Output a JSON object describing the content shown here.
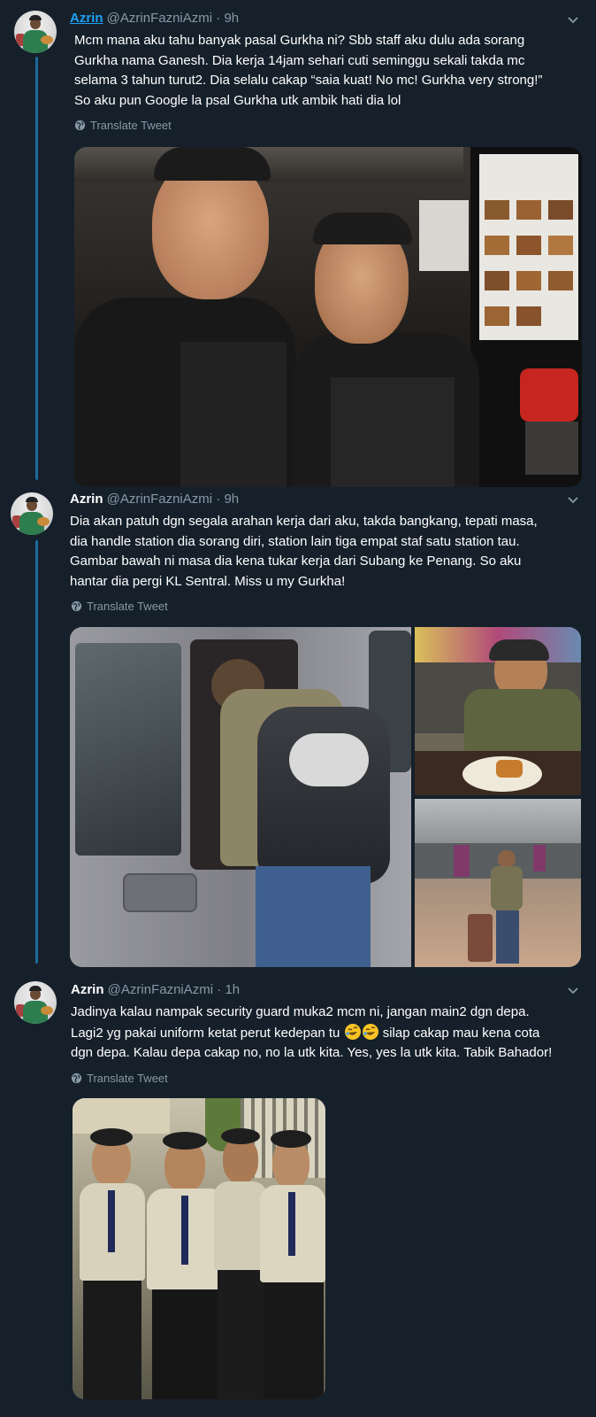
{
  "tweets": [
    {
      "name": "Azrin",
      "handle": "@AzrinFazniAzmi",
      "time": "9h",
      "lines": [
        "Mcm mana aku tahu banyak pasal Gurkha ni? Sbb staff aku dulu ada sorang",
        "Gurkha nama Ganesh. Dia kerja 14jam sehari cuti seminggu sekali takda mc",
        "selama 3 tahun turut2. Dia selalu cakap “saia kuat! No mc! Gurkha very strong!”",
        "So aku pun Google la psal Gurkha utk ambik hati dia lol"
      ],
      "translate": "Translate Tweet"
    },
    {
      "name": "Azrin",
      "handle": "@AzrinFazniAzmi",
      "time": "9h",
      "lines": [
        "Dia akan patuh dgn segala arahan kerja dari aku, takda bangkang, tepati masa,",
        "dia handle station dia sorang diri, station lain tiga empat staf satu station tau.",
        "Gambar bawah ni masa dia kena tukar kerja dari Subang ke Penang. So aku",
        "hantar dia pergi KL Sentral. Miss u my Gurkha!"
      ],
      "translate": "Translate Tweet"
    },
    {
      "name": "Azrin",
      "handle": "@AzrinFazniAzmi",
      "time": "1h",
      "line1": "Jadinya kalau nampak security guard muka2 mcm ni, jangan main2 dgn depa.",
      "line2a": "Lagi2 yg pakai uniform ketat perut kedepan tu",
      "line2b": "silap cakap mau kena cota",
      "line3": "dgn depa. Kalau depa cakap no, no la utk kita. Yes, yes la utk kita. Tabik Bahador!",
      "translate": "Translate Tweet"
    }
  ],
  "separator": "·",
  "icons": {
    "caret": "chevron-down-icon",
    "globe": "globe-icon",
    "emoji": "rolling-on-floor-laughing-emoji"
  },
  "colors": {
    "background": "#15202b",
    "thread_line": "#1d6a9a",
    "secondary_text": "#8899a6",
    "link": "#1da1f2"
  }
}
